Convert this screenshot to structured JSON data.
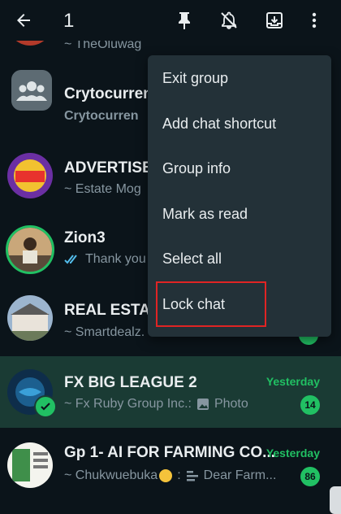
{
  "header": {
    "selected_count": "1",
    "icons": [
      "back-arrow-icon",
      "pin-icon",
      "mute-icon",
      "archive-icon",
      "more-vert-icon"
    ]
  },
  "chats": [
    {
      "name": "",
      "subtitle": "~ TheOluwag"
    },
    {
      "name": "Crytocurren",
      "subtitle": "Crytocurren"
    },
    {
      "name": "ADVERTISE",
      "subtitle": "~ Estate Mog"
    },
    {
      "name": "Zion3",
      "subtitle": "Thank you"
    },
    {
      "name": "REAL ESTAT",
      "subtitle": "~ Smartdealz."
    },
    {
      "name": "FX BIG LEAGUE 2",
      "time": "Yesterday",
      "sender": "~ Fx Ruby Group Inc.:",
      "preview": "Photo",
      "badge": "14"
    },
    {
      "name": "Gp 1- AI FOR FARMING CO...",
      "time": "Yesterday",
      "sender": "~ Chukwuebuka",
      "preview": "Dear Farm...",
      "badge": "86"
    }
  ],
  "menu": {
    "items": [
      "Exit group",
      "Add chat shortcut",
      "Group info",
      "Mark as read",
      "Select all",
      "Lock chat"
    ]
  },
  "colors": {
    "background": "#0b141a",
    "selected_row": "#1a3b34",
    "accent_green": "#21c063",
    "menu_bg": "#233138",
    "highlight_red": "#e02424"
  }
}
